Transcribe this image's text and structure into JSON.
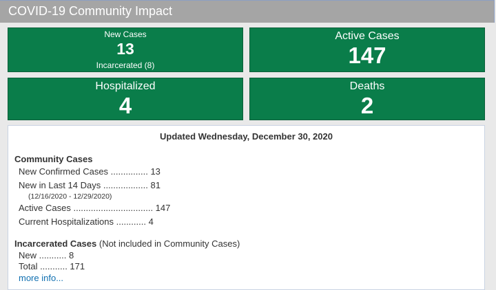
{
  "header": {
    "title": "COVID-19 Community Impact"
  },
  "tiles": {
    "new_cases": {
      "label": "New Cases",
      "value": "13",
      "sub": "Incarcerated (8)"
    },
    "active_cases": {
      "label": "Active Cases",
      "value": "147"
    },
    "hospitalized": {
      "label": "Hospitalized",
      "value": "4"
    },
    "deaths": {
      "label": "Deaths",
      "value": "2"
    }
  },
  "details": {
    "updated": "Updated Wednesday, December 30, 2020",
    "community": {
      "heading": "Community Cases",
      "new_confirmed": "New Confirmed Cases ............... 13",
      "last_14_days": "New in Last 14 Days .................. 81",
      "date_range": "(12/16/2020 - 12/29/2020)",
      "active": "Active Cases ................................ 147",
      "hospitalizations": "Current Hospitalizations ............ 4"
    },
    "incarcerated": {
      "heading": "Incarcerated Cases",
      "note": " (Not included in Community Cases)",
      "new": "New ........... 8",
      "total": "Total ........... 171"
    },
    "more_info": "more info..."
  },
  "colors": {
    "tile_green": "#0a7d4a",
    "header_gray": "#a5a5a5",
    "link_blue": "#0f6fb0"
  }
}
